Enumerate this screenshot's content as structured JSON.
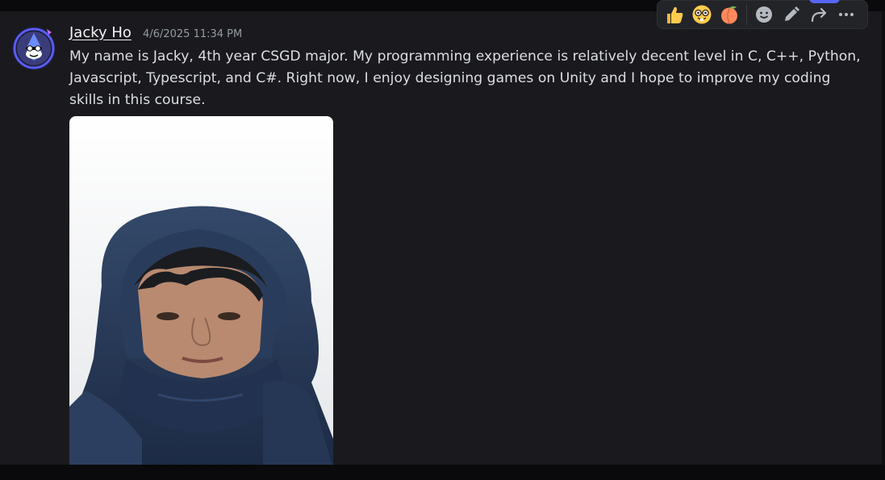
{
  "message": {
    "author": "Jacky Ho",
    "timestamp": "4/6/2025 11:34 PM",
    "text": "My name is Jacky, 4th year CSGD major. My programming experience is relatively decent level in C, C++, Python, Javascript, Typescript, and C#. Right now, I enjoy designing games on Unity and I hope to improve my coding skills in this course.",
    "attachment_icon": "selfie-photo",
    "avatar_icon": "blue-jay-avatar"
  },
  "toolbar": {
    "quick_reactions": [
      "thumbs-up-emoji",
      "nerd-face-emoji",
      "peach-emoji"
    ],
    "actions": [
      "add-reaction-icon",
      "edit-pencil-icon",
      "forward-arrow-icon",
      "more-dots-icon"
    ]
  },
  "colors": {
    "background": "#1a1a1e",
    "accent": "#5865f2",
    "text": "#dbdee1",
    "muted": "#949ba4"
  }
}
